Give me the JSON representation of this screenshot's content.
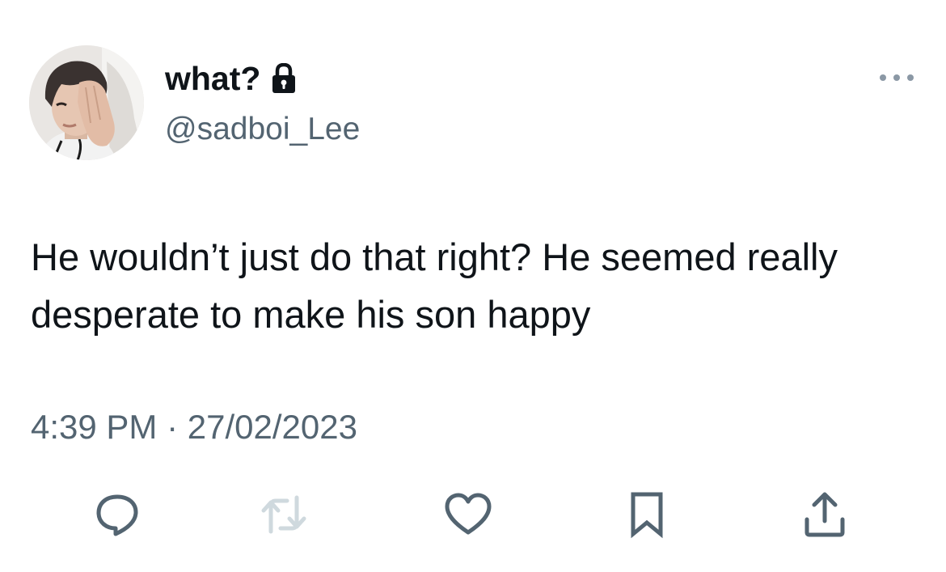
{
  "user": {
    "display_name": "what?",
    "handle": "@sadboi_Lee",
    "protected_icon": "lock-icon",
    "avatar_icon": "profile-photo"
  },
  "tweet": {
    "text": "He wouldn’t just do that right? He seemed really desperate to make his son happy",
    "time": "4:39 PM",
    "separator": "·",
    "date": "27/02/2023"
  },
  "menu": {
    "icon": "more-icon"
  },
  "actions": [
    {
      "name": "reply",
      "icon": "reply-icon"
    },
    {
      "name": "retweet",
      "icon": "retweet-icon"
    },
    {
      "name": "like",
      "icon": "heart-icon"
    },
    {
      "name": "bookmark",
      "icon": "bookmark-icon"
    },
    {
      "name": "share",
      "icon": "share-icon"
    }
  ],
  "colors": {
    "text_primary": "#0f1419",
    "text_secondary": "#536471",
    "action_icon": "#536471",
    "retweet_disabled": "#cfd9de",
    "background": "#ffffff"
  }
}
